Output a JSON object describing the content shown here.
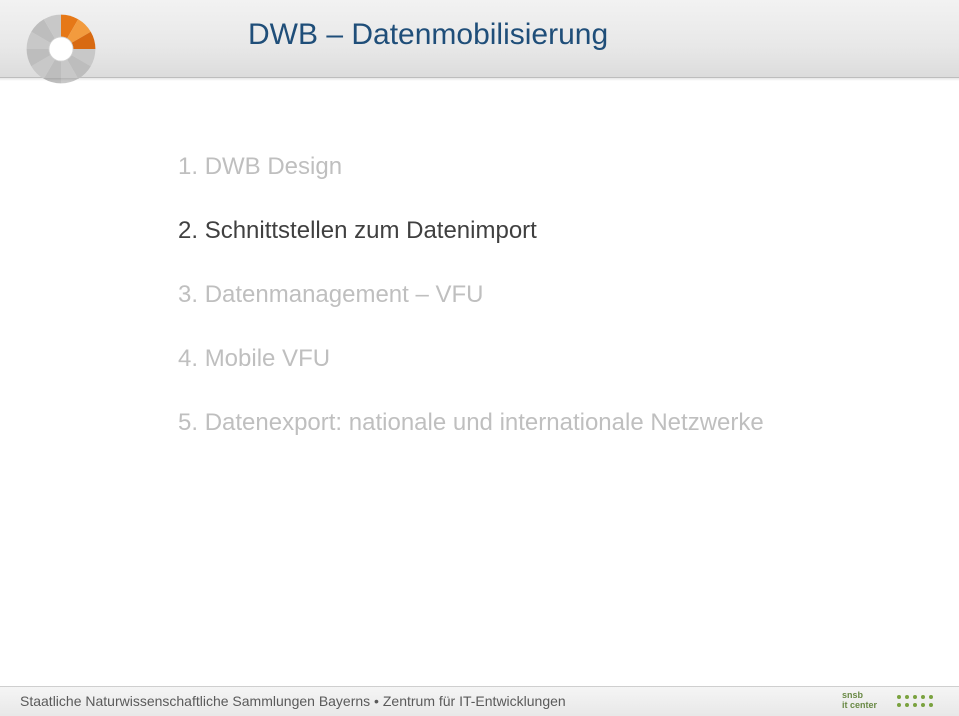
{
  "header": {
    "title": "DWB – Datenmobilisierung"
  },
  "items": [
    {
      "num": "1.",
      "text": "DWB Design",
      "muted": true
    },
    {
      "num": "2.",
      "text": "Schnittstellen zum Datenimport",
      "muted": false
    },
    {
      "num": "3.",
      "text": "Datenmanagement – VFU",
      "muted": true
    },
    {
      "num": "4.",
      "text": "Mobile VFU",
      "muted": true
    },
    {
      "num": "5.",
      "text": "Datenexport: nationale und internationale Netzwerke",
      "muted": true
    }
  ],
  "footer": {
    "text": "Staatliche Naturwissenschaftliche Sammlungen Bayerns • Zentrum für IT-Entwicklungen",
    "logo_line1": "snsb",
    "logo_line2": "it center"
  }
}
